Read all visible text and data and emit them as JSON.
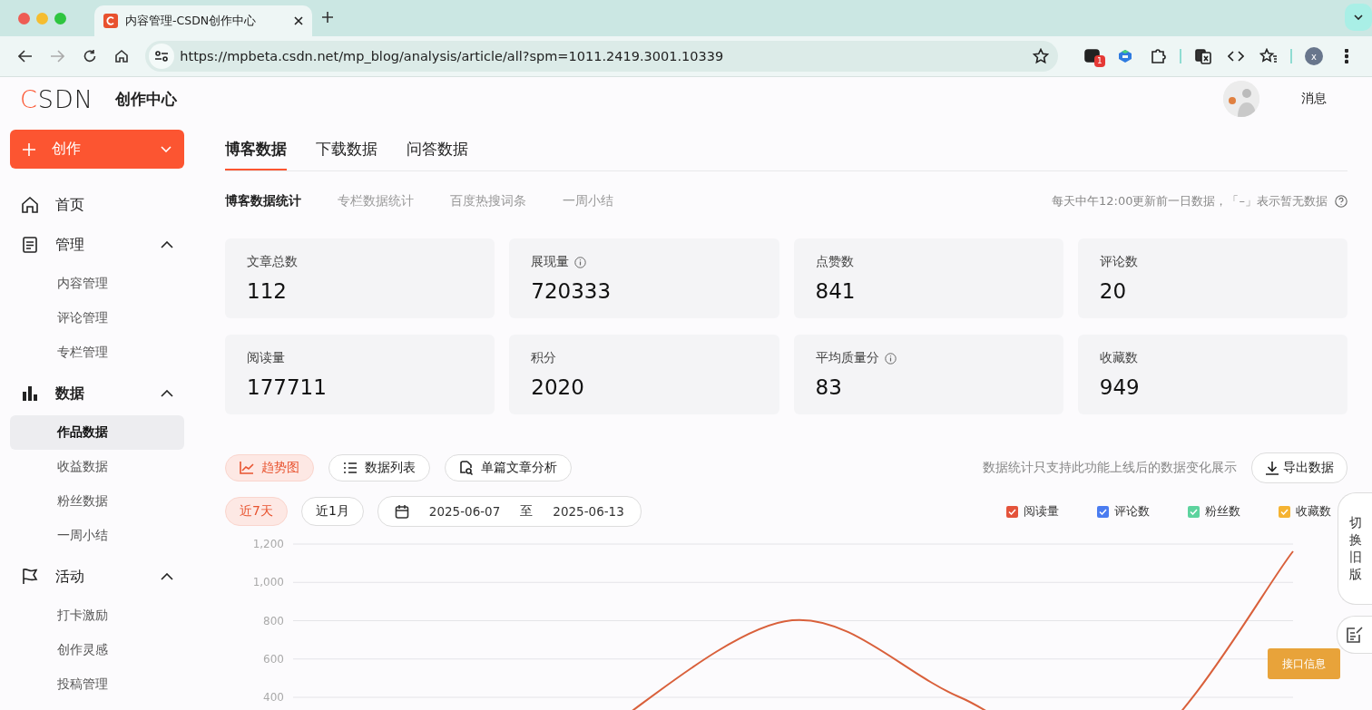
{
  "browser": {
    "tab_title": "内容管理-CSDN创作中心",
    "url": "https://mpbeta.csdn.net/mp_blog/analysis/article/all?spm=1011.2419.3001.10339",
    "extension_badge": "1",
    "profile_initial": "x"
  },
  "header": {
    "logo": "CSDN",
    "title": "创作中心",
    "messages": "消息"
  },
  "create_button": {
    "label": "创作"
  },
  "sidebar": {
    "items": [
      {
        "label": "首页",
        "kind": "link",
        "selected": false
      },
      {
        "label": "管理",
        "kind": "group",
        "expanded": true,
        "children": [
          {
            "label": "内容管理",
            "selected": false
          },
          {
            "label": "评论管理",
            "selected": false
          },
          {
            "label": "专栏管理",
            "selected": false
          }
        ]
      },
      {
        "label": "数据",
        "kind": "group",
        "expanded": true,
        "children": [
          {
            "label": "作品数据",
            "selected": true
          },
          {
            "label": "收益数据",
            "selected": false
          },
          {
            "label": "粉丝数据",
            "selected": false
          },
          {
            "label": "一周小结",
            "selected": false
          }
        ]
      },
      {
        "label": "活动",
        "kind": "group",
        "expanded": true,
        "children": [
          {
            "label": "打卡激励",
            "selected": false
          },
          {
            "label": "创作灵感",
            "selected": false
          },
          {
            "label": "投稿管理",
            "selected": false
          }
        ]
      }
    ]
  },
  "tabs": [
    {
      "label": "博客数据",
      "selected": true
    },
    {
      "label": "下载数据",
      "selected": false
    },
    {
      "label": "问答数据",
      "selected": false
    }
  ],
  "subtabs": [
    {
      "label": "博客数据统计",
      "selected": true
    },
    {
      "label": "专栏数据统计",
      "selected": false
    },
    {
      "label": "百度热搜词条",
      "selected": false
    },
    {
      "label": "一周小结",
      "selected": false
    }
  ],
  "update_note": "每天中午12:00更新前一日数据，「–」表示暂无数据",
  "stats": [
    {
      "label": "文章总数",
      "value": "112",
      "info": false
    },
    {
      "label": "展现量",
      "value": "720333",
      "info": true
    },
    {
      "label": "点赞数",
      "value": "841",
      "info": false
    },
    {
      "label": "评论数",
      "value": "20",
      "info": false
    },
    {
      "label": "阅读量",
      "value": "177711",
      "info": false
    },
    {
      "label": "积分",
      "value": "2020",
      "info": false
    },
    {
      "label": "平均质量分",
      "value": "83",
      "info": true
    },
    {
      "label": "收藏数",
      "value": "949",
      "info": false
    }
  ],
  "views": [
    {
      "label": "趋势图",
      "selected": true
    },
    {
      "label": "数据列表",
      "selected": false
    },
    {
      "label": "单篇文章分析",
      "selected": false
    }
  ],
  "views_note": "数据统计只支持此功能上线后的数据变化展示",
  "export_button": "导出数据",
  "ranges": [
    {
      "label": "近7天",
      "selected": true
    },
    {
      "label": "近1月",
      "selected": false
    }
  ],
  "date_range": {
    "start": "2025-06-07",
    "separator": "至",
    "end": "2025-06-13"
  },
  "legend": [
    {
      "label": "阅读量",
      "color": "#e4533b",
      "checked": true
    },
    {
      "label": "评论数",
      "color": "#4a7cf0",
      "checked": true
    },
    {
      "label": "粉丝数",
      "color": "#5dd39e",
      "checked": true
    },
    {
      "label": "收藏数",
      "color": "#f5b332",
      "checked": true
    }
  ],
  "trend_chart": {
    "y_labels": [
      "1,200",
      "1,000",
      "800",
      "600",
      "400"
    ]
  },
  "float": {
    "switch_label": "切换旧版",
    "api_button": "接口信息"
  }
}
